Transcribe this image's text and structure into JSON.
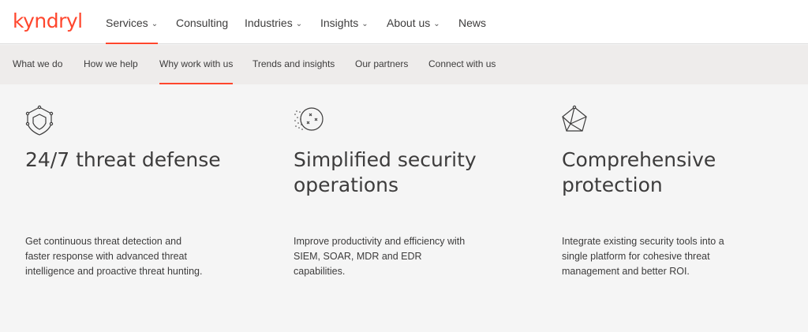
{
  "brand": {
    "logo_text": "kyndryl",
    "accent": "#ff462d"
  },
  "main_nav": [
    {
      "label": "Services",
      "has_dropdown": true,
      "active": true
    },
    {
      "label": "Consulting",
      "has_dropdown": false,
      "active": false
    },
    {
      "label": "Industries",
      "has_dropdown": true,
      "active": false
    },
    {
      "label": "Insights",
      "has_dropdown": true,
      "active": false
    },
    {
      "label": "About us",
      "has_dropdown": true,
      "active": false
    },
    {
      "label": "News",
      "has_dropdown": false,
      "active": false
    }
  ],
  "sub_nav": [
    {
      "label": "What we do",
      "active": false
    },
    {
      "label": "How we help",
      "active": false
    },
    {
      "label": "Why work with us",
      "active": true
    },
    {
      "label": "Trends and insights",
      "active": false
    },
    {
      "label": "Our partners",
      "active": false
    },
    {
      "label": "Connect with us",
      "active": false
    }
  ],
  "features": [
    {
      "icon": "shield-icon",
      "title": "24/7 threat defense",
      "description": "Get continuous threat detection and faster response with advanced threat intelligence and proactive threat hunting."
    },
    {
      "icon": "scatter-circle-icon",
      "title": "Simplified security operations",
      "description": "Improve productivity and efficiency with SIEM, SOAR, MDR and EDR capabilities."
    },
    {
      "icon": "polyhedron-icon",
      "title": "Comprehensive protection",
      "description": "Integrate existing security tools into a single platform for cohesive threat management and better ROI."
    }
  ]
}
